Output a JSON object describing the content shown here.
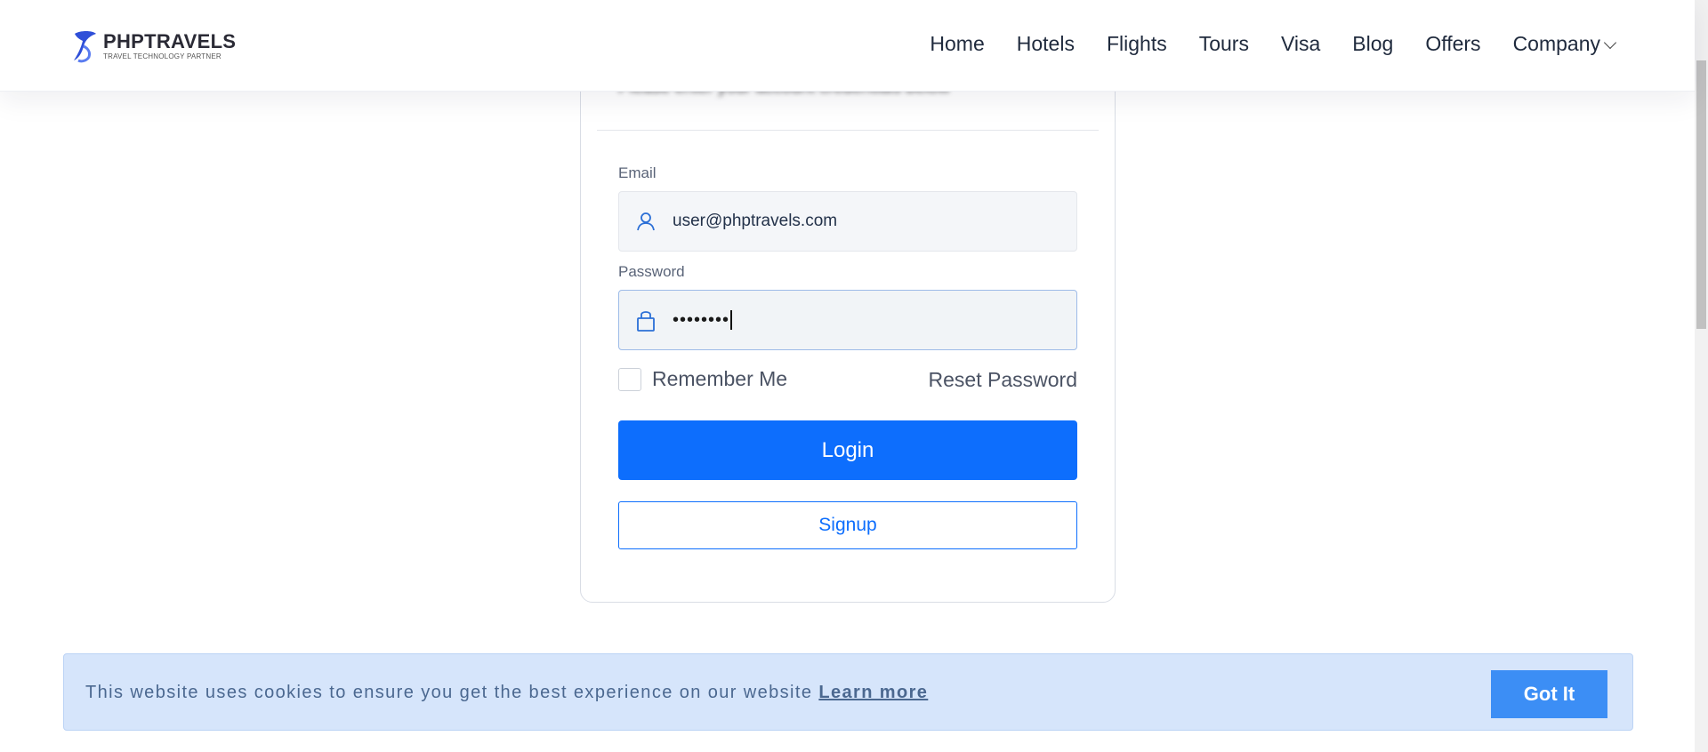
{
  "header": {
    "logo_name": "PHPTRAVELS",
    "logo_tagline": "TRAVEL TECHNOLOGY PARTNER",
    "nav": [
      {
        "label": "Home"
      },
      {
        "label": "Hotels"
      },
      {
        "label": "Flights"
      },
      {
        "label": "Tours"
      },
      {
        "label": "Visa"
      },
      {
        "label": "Blog"
      },
      {
        "label": "Offers"
      },
      {
        "label": "Company"
      }
    ]
  },
  "login": {
    "subtitle": "Please enter your account credentials below",
    "email_label": "Email",
    "email_value": "user@phptravels.com",
    "password_label": "Password",
    "password_value": "••••••••",
    "remember_label": "Remember Me",
    "remember_checked": false,
    "reset_label": "Reset Password",
    "login_label": "Login",
    "signup_label": "Signup"
  },
  "cookie": {
    "text": "This website uses cookies to ensure you get the best experience on our website",
    "link": "Learn more",
    "button": "Got It"
  },
  "colors": {
    "primary": "#0d6efd",
    "cookie_bg": "#d6e5fb",
    "cookie_button": "#3c8ef5"
  }
}
